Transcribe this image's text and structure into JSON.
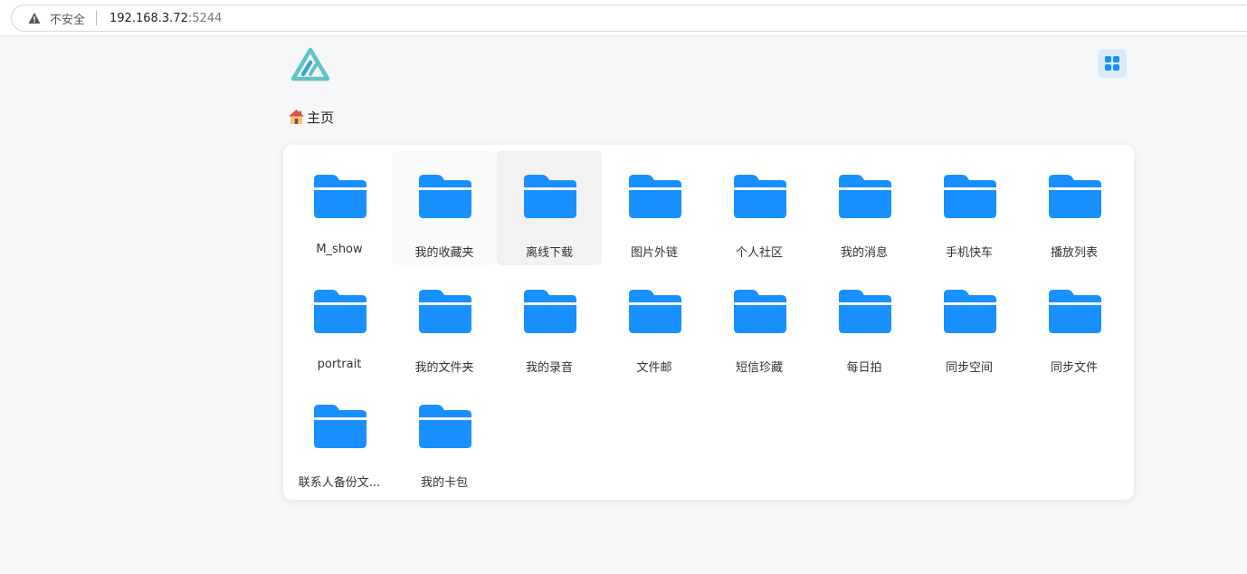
{
  "browser": {
    "security_label": "不安全",
    "host": "192.168.3.72",
    "port": ":5244"
  },
  "breadcrumb": {
    "label": "主页"
  },
  "colors": {
    "folder": "#1890ff",
    "logo": "#5fc4c5",
    "grid_button_bg": "#d9ebfb"
  },
  "icons": {
    "logo": "alist-logo-icon",
    "layout_toggle": "grid-icon",
    "home": "home-icon",
    "folder": "folder-icon"
  },
  "folders": [
    {
      "name": "M_show"
    },
    {
      "name": "我的收藏夹"
    },
    {
      "name": "离线下载"
    },
    {
      "name": "图片外链"
    },
    {
      "name": "个人社区"
    },
    {
      "name": "我的消息"
    },
    {
      "name": "手机快车"
    },
    {
      "name": "播放列表"
    },
    {
      "name": "portrait"
    },
    {
      "name": "我的文件夹"
    },
    {
      "name": "我的录音"
    },
    {
      "name": "文件邮"
    },
    {
      "name": "短信珍藏"
    },
    {
      "name": "每日拍"
    },
    {
      "name": "同步空间"
    },
    {
      "name": "同步文件"
    },
    {
      "name": "联系人备份文..."
    },
    {
      "name": "我的卡包"
    }
  ]
}
